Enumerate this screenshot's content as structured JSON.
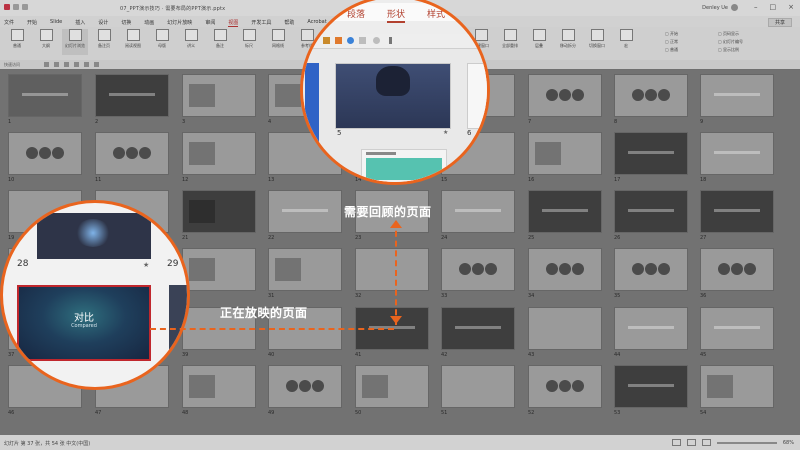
{
  "titlebar": {
    "doc_title": "07_PPT演示技巧 · 需要布局的PPT演示.pptx",
    "user": "Denley Ue"
  },
  "menu": {
    "items": [
      "文件",
      "开始",
      "Slide",
      "插入",
      "设计",
      "切换",
      "动画",
      "幻灯片放映",
      "审阅",
      "视图",
      "开发工具",
      "帮助",
      "Acrobat",
      "Denley Ue"
    ],
    "active_index": 9,
    "share": "共享"
  },
  "ribbon": {
    "buttons": [
      "普通",
      "大纲",
      "幻灯片浏览",
      "备注页",
      "阅读视图",
      "母版",
      "讲义",
      "备注",
      "标尺",
      "网格线",
      "参考线",
      "显示比例",
      "适应窗口",
      "颜色",
      "灰度",
      "黑白",
      "新建窗口",
      "全部重排",
      "层叠",
      "移动拆分",
      "切换窗口",
      "宏"
    ],
    "opts_col1": [
      "开始",
      "正常",
      "普通"
    ],
    "opts_col2": [
      "页码显示",
      "幻灯片编号",
      "显示比例"
    ]
  },
  "strip": {
    "label": "快速访问",
    "tool_count_text": ""
  },
  "grid": {
    "slide_numbers": [
      "1",
      "2",
      "3",
      "4",
      "5",
      "6",
      "7",
      "8",
      "9",
      "10",
      "11",
      "12",
      "13",
      "14",
      "15",
      "16",
      "17",
      "18",
      "19",
      "20",
      "21",
      "22",
      "23",
      "24",
      "25",
      "26",
      "27",
      "28",
      "29",
      "30",
      "31",
      "32",
      "33",
      "34",
      "35",
      "36",
      "37",
      "38",
      "39",
      "40",
      "41",
      "42",
      "43",
      "44",
      "45",
      "46",
      "47",
      "48",
      "49",
      "50",
      "51",
      "52",
      "53",
      "54"
    ]
  },
  "status": {
    "left": "幻灯片 第 37 张，共 54 张   中文(中国)",
    "right": "68%"
  },
  "magnifier_top": {
    "tabs": [
      "段落",
      "形状",
      "样式"
    ],
    "active_tab": "形状",
    "slide_number_a": "5",
    "slide_number_b": "6",
    "star": "★"
  },
  "magnifier_bottom": {
    "slide_number_top_a": "28",
    "slide_number_top_b": "29",
    "current_title": "对比",
    "current_subtitle": "Compared",
    "current_number": "37",
    "next_number": "38",
    "star": "★"
  },
  "annotations": {
    "review_page": "需要回顾的页面",
    "playing_page": "正在放映的页面"
  },
  "colors": {
    "accent": "#e9641e",
    "current_slide_border": "#c0272d",
    "tab_red": "#b2412f"
  }
}
